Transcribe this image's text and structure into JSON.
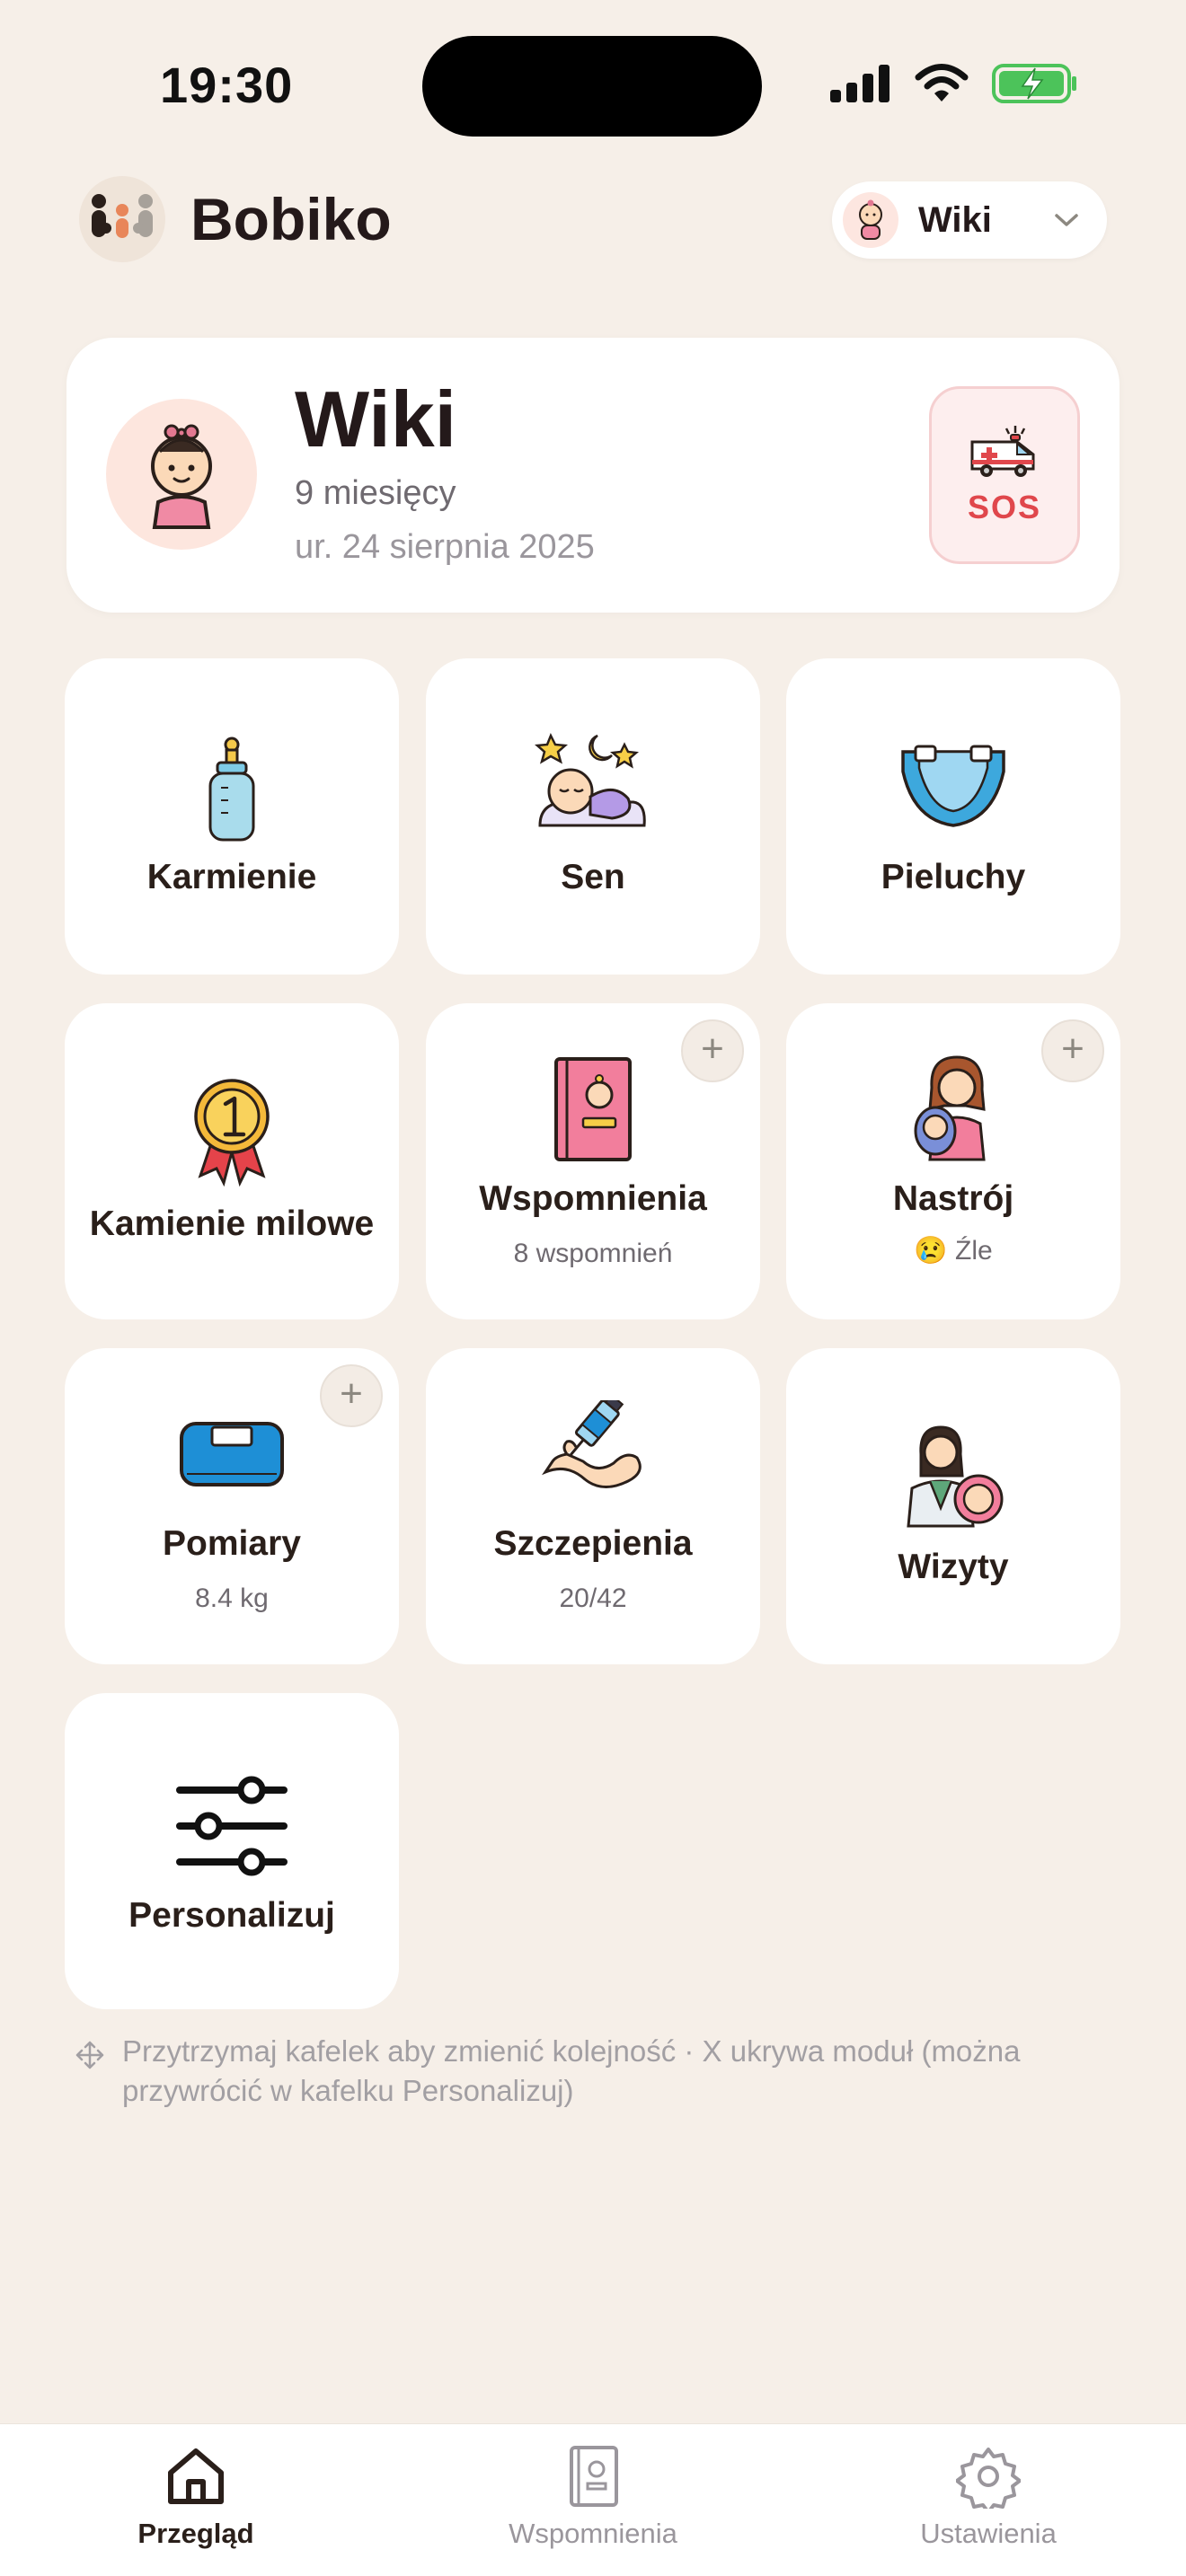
{
  "status_bar": {
    "time": "19:30"
  },
  "header": {
    "brand": "Bobiko",
    "child_selector": {
      "name": "Wiki"
    }
  },
  "profile": {
    "name": "Wiki",
    "age": "9 miesięcy",
    "birth": "ur. 24 sierpnia 2025",
    "sos_label": "SOS"
  },
  "tiles": [
    {
      "title": "Karmienie",
      "icon": "baby-bottle-icon"
    },
    {
      "title": "Sen",
      "icon": "sleeping-baby-icon"
    },
    {
      "title": "Pieluchy",
      "icon": "diaper-icon"
    },
    {
      "title": "Kamienie milowe",
      "icon": "medal-icon"
    },
    {
      "title": "Wspomnienia",
      "subtitle": "8 wspomnień",
      "icon": "memory-book-icon",
      "has_add": true
    },
    {
      "title": "Nastrój",
      "subtitle": "😢 Źle",
      "icon": "mother-baby-icon",
      "has_add": true
    },
    {
      "title": "Pomiary",
      "subtitle": "8.4 kg",
      "icon": "scale-icon",
      "has_add": true
    },
    {
      "title": "Szczepienia",
      "subtitle": "20/42",
      "icon": "vaccine-icon"
    },
    {
      "title": "Wizyty",
      "icon": "doctor-icon"
    },
    {
      "title": "Personalizuj",
      "icon": "sliders-icon"
    }
  ],
  "hint": "Przytrzymaj kafelek aby zmienić kolejność · X ukrywa moduł (można przywrócić w kafelku Personalizuj)",
  "tab_bar": {
    "tabs": [
      {
        "label": "Przegląd",
        "active": true
      },
      {
        "label": "Wspomnienia",
        "active": false
      },
      {
        "label": "Ustawienia",
        "active": false
      }
    ]
  },
  "colors": {
    "background": "#f6efe8",
    "sos": "#e0474c",
    "active_tab": "#2a1f1a",
    "inactive_tab": "#9a969c"
  }
}
